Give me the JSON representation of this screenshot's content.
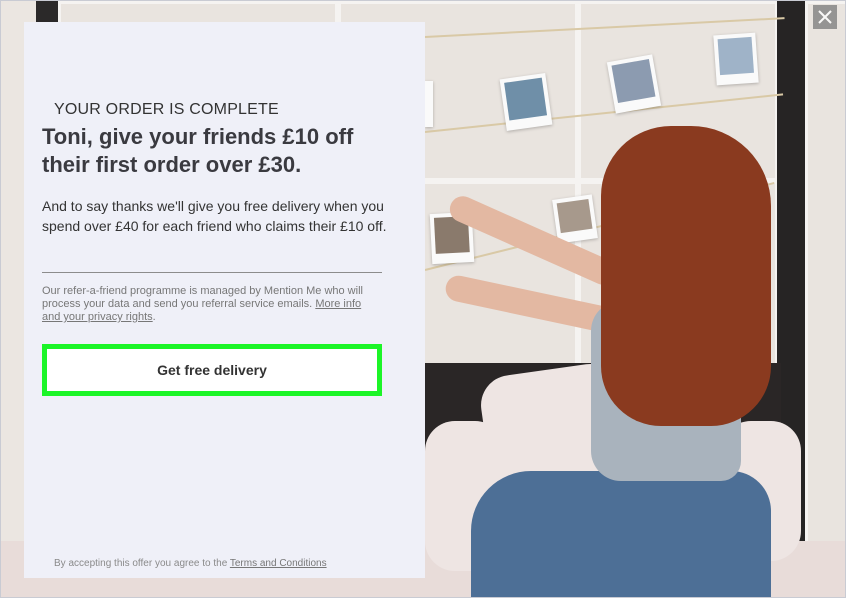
{
  "modal": {
    "close_icon": "close-icon",
    "panel": {
      "eyebrow": "YOUR ORDER IS COMPLETE",
      "headline": "Toni, give your friends £10 off their first order over £30.",
      "subtext": "And to say thanks we'll give you free delivery when you spend over £40 for each friend who claims their £10 off.",
      "privacy_text": "Our refer-a-friend programme is managed by Mention Me who will process your data and send you referral service emails.",
      "privacy_link": "More info and your privacy rights",
      "privacy_end": ".",
      "cta_label": "Get free delivery",
      "terms_text": "By accepting this offer you agree to the",
      "terms_link": "Terms and Conditions"
    },
    "colors": {
      "panel_bg": "#eff0f8",
      "cta_border": "#1cf528"
    }
  }
}
